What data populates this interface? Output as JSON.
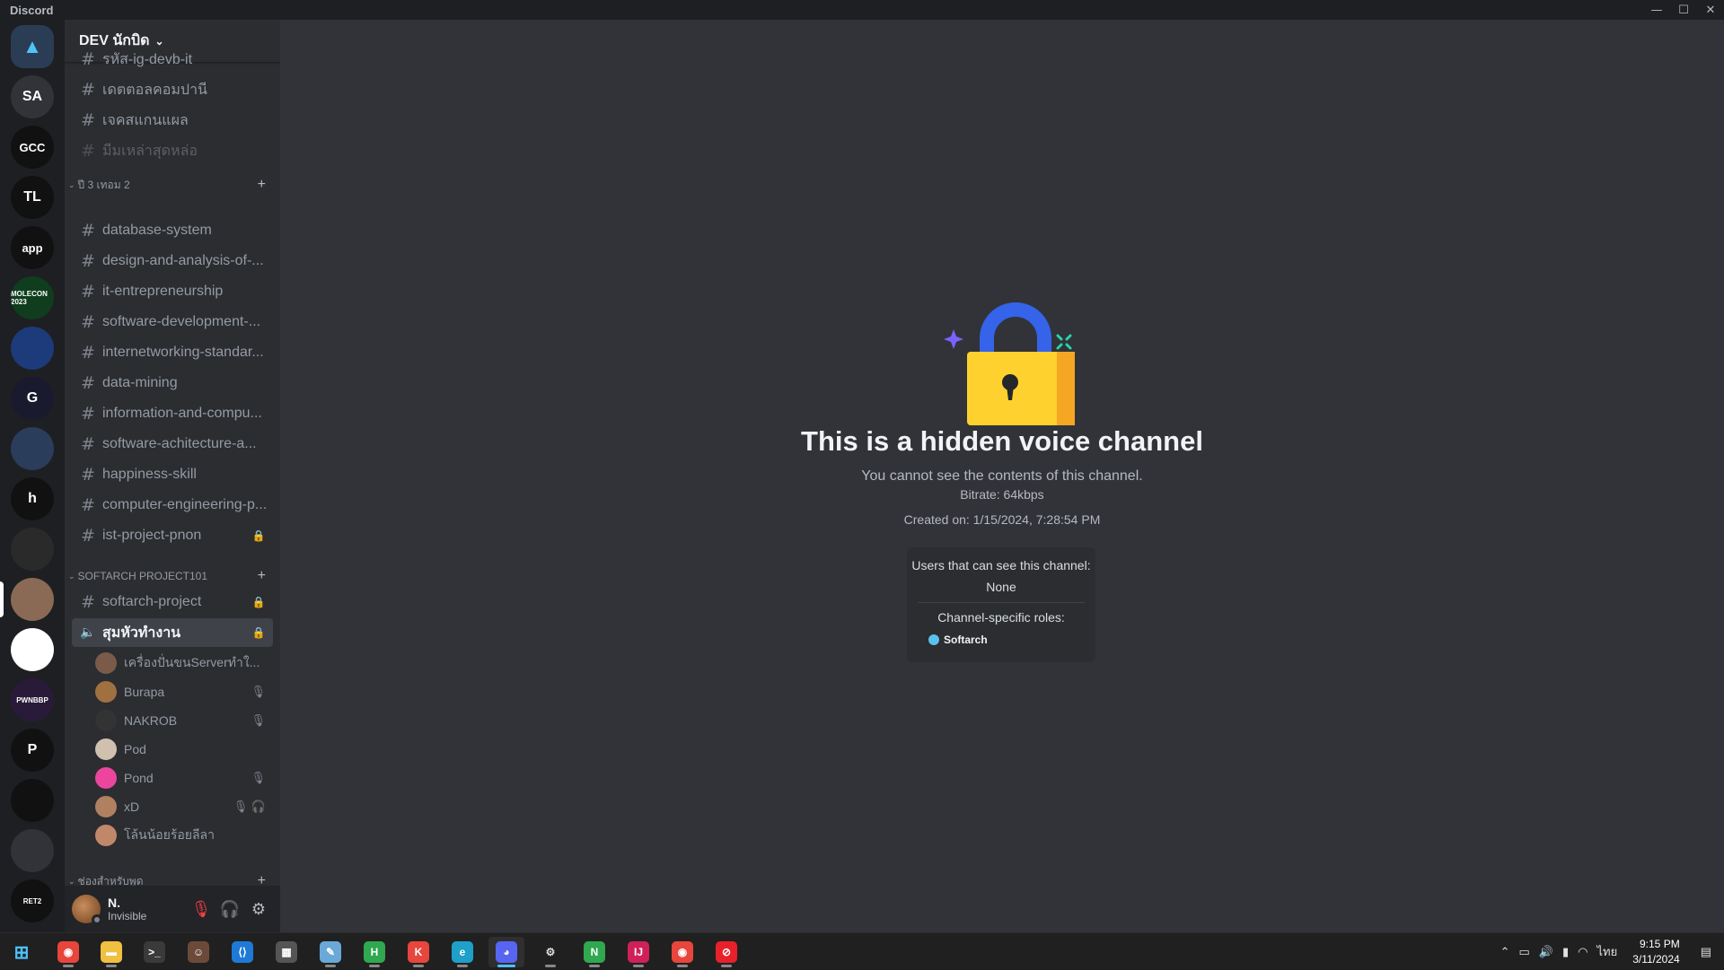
{
  "window": {
    "title": "Discord",
    "minimize": "—",
    "maximize": "☐",
    "close": "✕"
  },
  "guilds": [
    {
      "name": "discord-home",
      "label": "",
      "bg": "#313338"
    },
    {
      "name": "server-sa",
      "label": "SA",
      "bg": "#313338"
    },
    {
      "name": "server-gcc",
      "label": "GCC",
      "bg": "#111111"
    },
    {
      "name": "server-tl",
      "label": "TL",
      "bg": "#111111"
    },
    {
      "name": "server-app",
      "label": "app",
      "bg": "#111111"
    },
    {
      "name": "server-molecon",
      "label": "MOLECON 2023",
      "bg": "#0f3d1e"
    },
    {
      "name": "server-shield",
      "label": "",
      "bg": "#1d3a7a"
    },
    {
      "name": "server-blue-g",
      "label": "G",
      "bg": "#1a1a2e"
    },
    {
      "name": "server-mountain",
      "label": "",
      "bg": "#2a3d5a"
    },
    {
      "name": "server-h",
      "label": "h",
      "bg": "#111111"
    },
    {
      "name": "server-gear",
      "label": "",
      "bg": "#2a2a2a"
    },
    {
      "name": "server-face",
      "label": "",
      "bg": "#8a6a55"
    },
    {
      "name": "server-thailand",
      "label": "",
      "bg": "#ffffff"
    },
    {
      "name": "server-pwnbbp",
      "label": "PWNBBP",
      "bg": "#2a1a3a"
    },
    {
      "name": "server-p",
      "label": "P",
      "bg": "#111111"
    },
    {
      "name": "server-penguin",
      "label": "",
      "bg": "#111111"
    },
    {
      "name": "server-x",
      "label": "",
      "bg": "#313338"
    },
    {
      "name": "server-ret2",
      "label": "RET2",
      "bg": "#111111"
    }
  ],
  "server": {
    "name": "DEV นักบิด",
    "chevron": "⌄"
  },
  "top_channels": [
    {
      "name": "รหัส-ig-devb-it",
      "muted": false
    },
    {
      "name": "เดตตอลคอมปานี",
      "muted": false
    },
    {
      "name": "เจคสแกนแผล",
      "muted": false
    },
    {
      "name": "มีมเหล่าสุดหล่อ",
      "muted": true
    }
  ],
  "category1": {
    "label": "ปี 3 เทอม 2",
    "channels": [
      {
        "name": "database-system",
        "locked": false
      },
      {
        "name": "design-and-analysis-of-...",
        "locked": false
      },
      {
        "name": "it-entrepreneurship",
        "locked": false
      },
      {
        "name": "software-development-...",
        "locked": false
      },
      {
        "name": "internetworking-standar...",
        "locked": false
      },
      {
        "name": "data-mining",
        "locked": false
      },
      {
        "name": "information-and-compu...",
        "locked": false
      },
      {
        "name": "software-achitecture-a...",
        "locked": false
      },
      {
        "name": "happiness-skill",
        "locked": false
      },
      {
        "name": "computer-engineering-p...",
        "locked": false
      },
      {
        "name": "ist-project-pnon",
        "locked": true
      }
    ]
  },
  "category2": {
    "label": "SOFTARCH PROJECT101",
    "text_channel": "softarch-project",
    "voice_channel": "สุมหัวทำงาน"
  },
  "voice_users": [
    {
      "name": "เครื่องปั่นขนServerทำใ...",
      "color": "#7a5b4a",
      "status": ""
    },
    {
      "name": "Burapa",
      "color": "#a07040",
      "status": "🎙"
    },
    {
      "name": "NAKROB",
      "color": "#333333",
      "status": "🎙"
    },
    {
      "name": "Pod",
      "color": "#d0c0b0",
      "status": ""
    },
    {
      "name": "Pond",
      "color": "#eb459e",
      "status": "🎙"
    },
    {
      "name": "xD",
      "color": "#b08060",
      "status": "🎙 🎧"
    },
    {
      "name": "โล้นน้อยร้อยลีลา",
      "color": "#c08868",
      "status": ""
    }
  ],
  "category3": {
    "label": "ช่องสำหรับพูด"
  },
  "user_panel": {
    "name": "N.",
    "status": "Invisible"
  },
  "hidden_channel": {
    "title": "This is a hidden voice channel",
    "subtitle": "You cannot see the contents of this channel.",
    "bitrate": "Bitrate: 64kbps",
    "created": "Created on: 1/15/2024, 7:28:54 PM",
    "users_label": "Users that can see this channel:",
    "users_value": "None",
    "roles_label": "Channel-specific roles:",
    "role_name": "Softarch",
    "role_color": "#5bc0eb"
  },
  "taskbar": {
    "apps": [
      {
        "name": "start-button",
        "label": "⊞",
        "bg": "transparent",
        "color": "#4cc2ff",
        "active": false
      },
      {
        "name": "chrome-1",
        "label": "◉",
        "bg": "#e8453c",
        "color": "#fff",
        "active": false
      },
      {
        "name": "file-explorer",
        "label": "▬",
        "bg": "#f0c040",
        "color": "#fff",
        "active": false
      },
      {
        "name": "terminal",
        "label": ">_",
        "bg": "#3a3a3a",
        "color": "#fff",
        "active": false
      },
      {
        "name": "photo-app",
        "label": "☺",
        "bg": "#6b4a3a",
        "color": "#fff",
        "active": false
      },
      {
        "name": "vscode",
        "label": "⟨⟩",
        "bg": "#1e7ad6",
        "color": "#fff",
        "active": false
      },
      {
        "name": "ssh-client",
        "label": "▦",
        "bg": "#555555",
        "color": "#fff",
        "active": false
      },
      {
        "name": "notes-app",
        "label": "✎",
        "bg": "#6aa8d8",
        "color": "#fff",
        "active": false
      },
      {
        "name": "chrome-2",
        "label": "H",
        "bg": "#2fa84f",
        "color": "#fff",
        "active": false
      },
      {
        "name": "chrome-3",
        "label": "K",
        "bg": "#e8453c",
        "color": "#fff",
        "active": false
      },
      {
        "name": "edge",
        "label": "e",
        "bg": "#1ea0c8",
        "color": "#fff",
        "active": false
      },
      {
        "name": "discord",
        "label": "◕",
        "bg": "#5865f2",
        "color": "#fff",
        "active": true
      },
      {
        "name": "settings",
        "label": "⚙",
        "bg": "transparent",
        "color": "#ddd",
        "active": false
      },
      {
        "name": "chrome-4",
        "label": "N",
        "bg": "#2fa84f",
        "color": "#fff",
        "active": false
      },
      {
        "name": "jetbrains",
        "label": "IJ",
        "bg": "#d0205a",
        "color": "#fff",
        "active": false
      },
      {
        "name": "chrome-5",
        "label": "◉",
        "bg": "#e8453c",
        "color": "#fff",
        "active": false
      },
      {
        "name": "red-app",
        "label": "⊘",
        "bg": "#e8202a",
        "color": "#fff",
        "active": false
      }
    ],
    "lang": "ไทย",
    "time": "9:15 PM",
    "date": "3/11/2024"
  }
}
